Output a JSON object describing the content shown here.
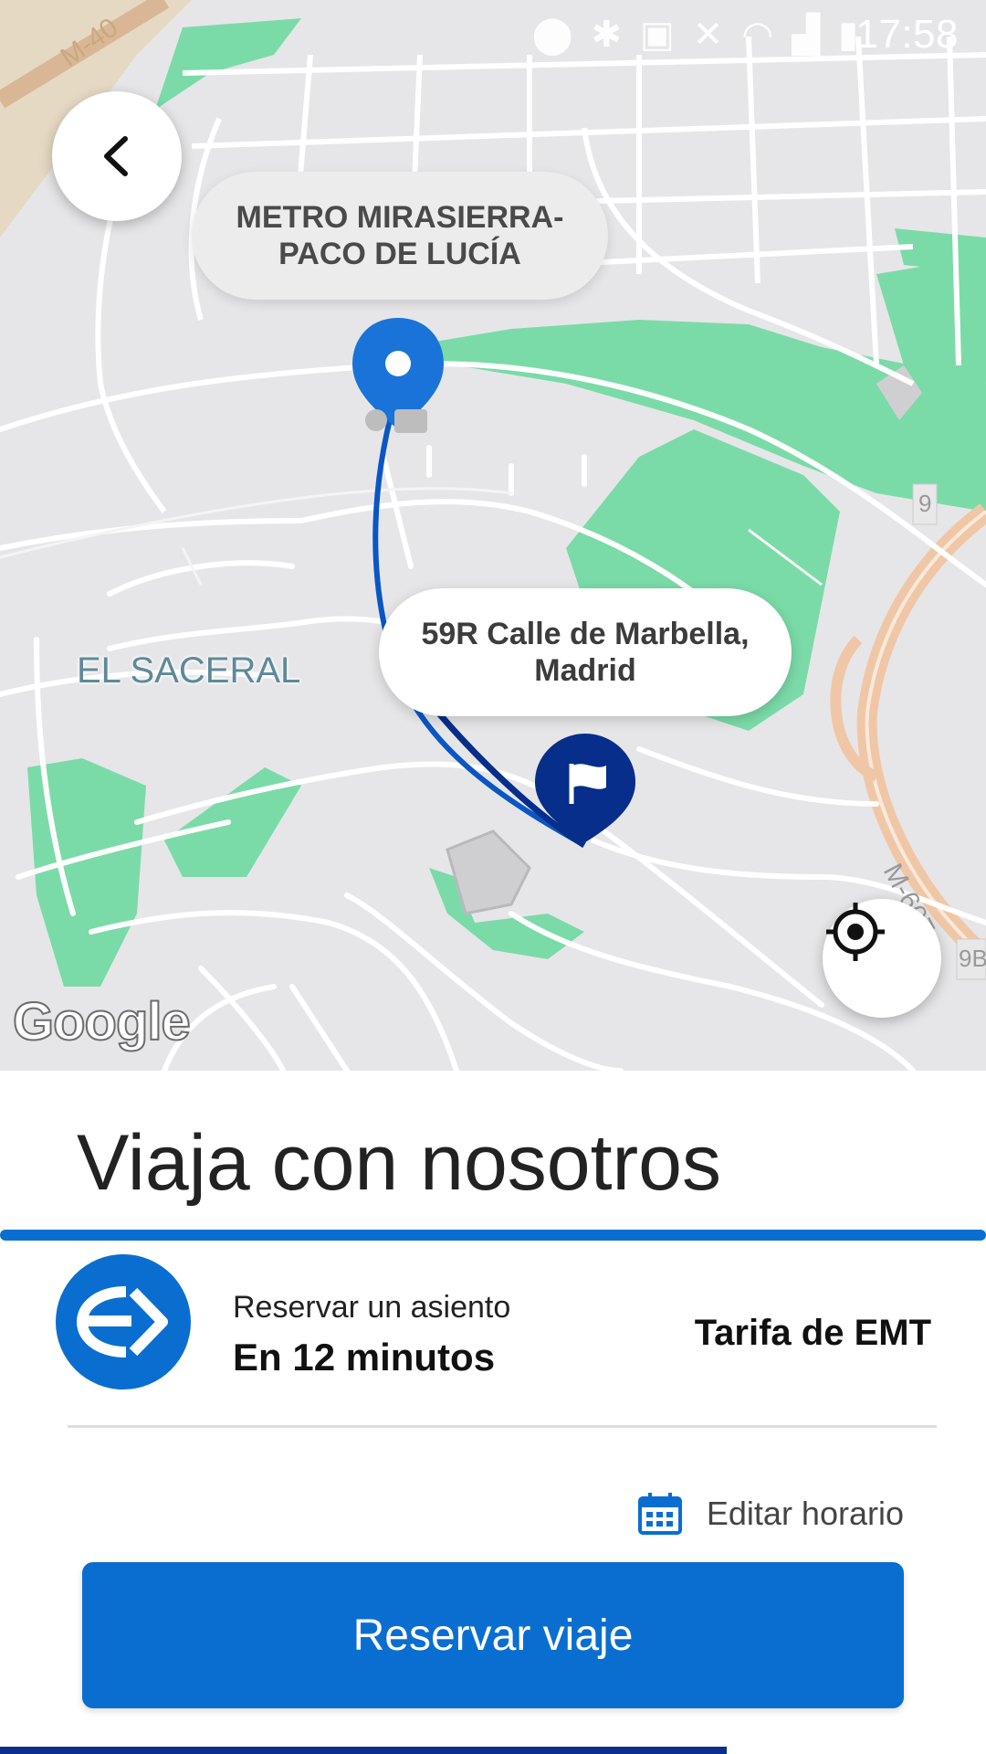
{
  "status_bar": {
    "time": "17:58",
    "icons": [
      "location-icon",
      "bluetooth-icon",
      "nfc-icon",
      "mute-icon",
      "wifi-icon",
      "signal-icon",
      "battery-icon"
    ]
  },
  "map": {
    "origin_label": "METRO MIRASIERRA-\nPACO DE LUCÍA",
    "origin_line1": "METRO MIRASIERRA-",
    "origin_line2": "PACO DE LUCÍA",
    "destination_line1": "59R Calle de Marbella,",
    "destination_line2": "Madrid",
    "area_label": "EL SACERAL",
    "road_labels": [
      "M-40",
      "M-607",
      "9",
      "9B"
    ],
    "attribution": "Google",
    "colors": {
      "route": "#0a56c5",
      "origin_pin": "#1a73d9",
      "destination_pin": "#062e8a",
      "park": "#7bdba8"
    }
  },
  "sheet": {
    "title": "Viaja con nosotros",
    "option": {
      "subtitle": "Reservar un asiento",
      "title": "En 12 minutos",
      "price": "Tarifa de EMT"
    },
    "edit_schedule": "Editar horario",
    "reserve_button": "Reservar viaje"
  },
  "colors": {
    "accent": "#0a6ed1",
    "dark_accent": "#0b2f8a"
  }
}
